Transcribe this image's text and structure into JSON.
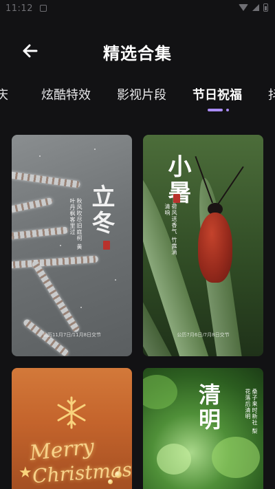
{
  "status_bar": {
    "time": "11:12",
    "icons": [
      "notification-icon",
      "wifi-icon",
      "signal-icon",
      "battery-icon"
    ]
  },
  "header": {
    "back_icon": "arrow-left-icon",
    "title": "精选合集"
  },
  "tabs": {
    "items": [
      {
        "label": "庆"
      },
      {
        "label": "炫酷特效"
      },
      {
        "label": "影视片段"
      },
      {
        "label": "节日祝福"
      },
      {
        "label": "抖"
      }
    ],
    "active_index": 3,
    "accent_color": "#a98cf5"
  },
  "cards": [
    {
      "title": "立冬",
      "poem": "秋风吹尽旧庭柯 黄叶丹枫客里过",
      "footer": "公历11月7日/11月8日交节"
    },
    {
      "title": "小暑",
      "poem": "荷风送香气 竹露滴清响",
      "footer": "公历7月6日/7月8日交节"
    },
    {
      "title_line1": "Merry",
      "title_line2": "Christmas"
    },
    {
      "title": "清明",
      "poem": "桑子来时新社 梨花落后清明"
    }
  ],
  "colors": {
    "background": "#121214",
    "text": "#ffffff",
    "accent": "#a98cf5"
  }
}
